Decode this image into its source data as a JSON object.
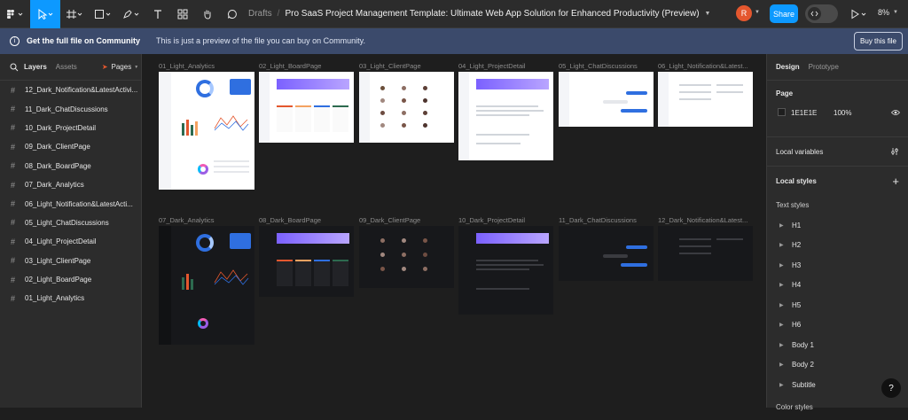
{
  "toolbar": {
    "breadcrumb_drafts": "Drafts",
    "breadcrumb_sep": "/",
    "file_title": "Pro SaaS Project Management Template: Ultimate Web App Solution for Enhanced Productivity (Preview)",
    "avatar_initial": "R",
    "share_label": "Share",
    "zoom_level": "8%"
  },
  "banner": {
    "headline": "Get the full file on Community",
    "message": "This is just a preview of the file you can buy on Community.",
    "buy_label": "Buy this file"
  },
  "left_panel": {
    "tabs": {
      "layers": "Layers",
      "assets": "Assets",
      "pages": "Pages"
    },
    "layers": [
      "12_Dark_Notification&LatestActivi...",
      "11_Dark_ChatDiscussions",
      "10_Dark_ProjectDetail",
      "09_Dark_ClientPage",
      "08_Dark_BoardPage",
      "07_Dark_Analytics",
      "06_Light_Notification&LatestActi...",
      "05_Light_ChatDiscussions",
      "04_Light_ProjectDetail",
      "03_Light_ClientPage",
      "02_Light_BoardPage",
      "01_Light_Analytics"
    ]
  },
  "canvas": {
    "light_frames": [
      "01_Light_Analytics",
      "02_Light_BoardPage",
      "03_Light_ClientPage",
      "04_Light_ProjectDetail",
      "05_Light_ChatDiscussions",
      "06_Light_Notification&Latest..."
    ],
    "dark_frames": [
      "07_Dark_Analytics",
      "08_Dark_BoardPage",
      "09_Dark_ClientPage",
      "10_Dark_ProjectDetail",
      "11_Dark_ChatDiscussions",
      "12_Dark_Notification&Latest..."
    ]
  },
  "right_panel": {
    "tabs": {
      "design": "Design",
      "prototype": "Prototype"
    },
    "page_heading": "Page",
    "page_color": "1E1E1E",
    "page_opacity": "100%",
    "local_variables": "Local variables",
    "local_styles": "Local styles",
    "text_styles_heading": "Text styles",
    "text_styles": [
      "H1",
      "H2",
      "H3",
      "H4",
      "H5",
      "H6",
      "Body 1",
      "Body 2",
      "Subtitle"
    ],
    "color_styles_heading": "Color styles",
    "help_label": "?"
  },
  "colors": {
    "accent": "#0d99ff",
    "banner": "#3b4a6b",
    "avatar": "#e4572e",
    "canvas": "#1e1e1e",
    "panel": "#2c2c2c"
  }
}
